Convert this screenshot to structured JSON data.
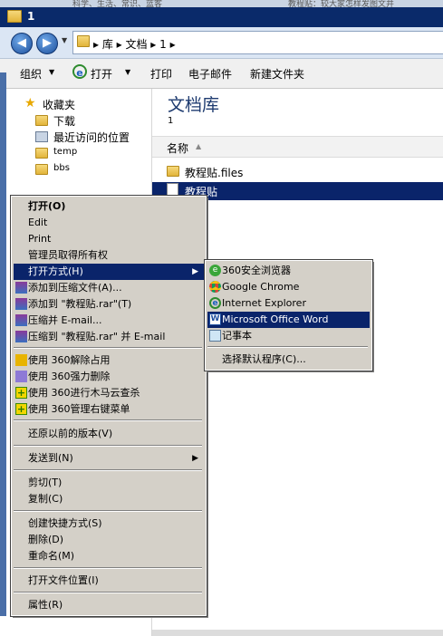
{
  "top_strip": {
    "left_text": "科学、生活、常识、蓝客",
    "right_text": "教程贴：较大家怎样发图文并"
  },
  "window": {
    "title": "1"
  },
  "address": {
    "breadcrumb": "▸ 库 ▸ 文档 ▸ 1 ▸"
  },
  "toolbar": {
    "organize": "组织",
    "open": "打开",
    "print": "打印",
    "email": "电子邮件",
    "new_folder": "新建文件夹"
  },
  "nav": {
    "favorites": "收藏夹",
    "downloads": "下载",
    "recent": "最近访问的位置",
    "temp": "temp",
    "bbs": "bbs"
  },
  "library": {
    "title": "文档库",
    "subtitle": "1"
  },
  "columns": {
    "name": "名称"
  },
  "files": [
    {
      "name": "教程贴.files"
    },
    {
      "name": "教程贴"
    }
  ],
  "context_menu": {
    "open": "打开(O)",
    "edit": "Edit",
    "print": "Print",
    "take_ownership": "管理员取得所有权",
    "open_with": "打开方式(H)",
    "add_archive": "添加到压缩文件(A)...",
    "add_rar": "添加到 \"教程贴.rar\"(T)",
    "compress_email": "压缩并 E-mail...",
    "compress_rar_email": "压缩到 \"教程贴.rar\" 并 E-mail",
    "unlock_360": "使用 360解除占用",
    "force_delete_360": "使用 360强力删除",
    "trojan_scan_360": "使用 360进行木马云查杀",
    "manage_menu_360": "使用 360管理右键菜单",
    "restore_versions": "还原以前的版本(V)",
    "send_to": "发送到(N)",
    "cut": "剪切(T)",
    "copy": "复制(C)",
    "create_shortcut": "创建快捷方式(S)",
    "delete": "删除(D)",
    "rename": "重命名(M)",
    "open_location": "打开文件位置(I)",
    "properties": "属性(R)"
  },
  "submenu": {
    "browser_360": "360安全浏览器",
    "chrome": "Google Chrome",
    "ie": "Internet Explorer",
    "word": "Microsoft Office Word",
    "notepad": "记事本",
    "choose_default": "选择默认程序(C)..."
  }
}
